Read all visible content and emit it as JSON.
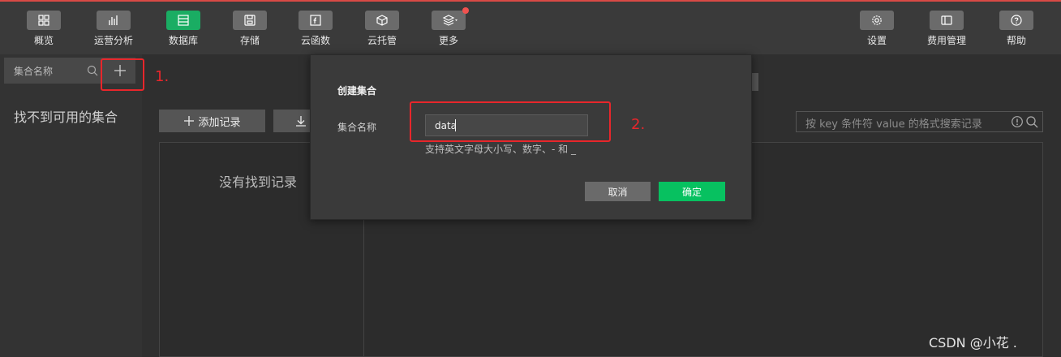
{
  "nav": {
    "left": [
      {
        "label": "概览",
        "icon": "overview-grid-icon"
      },
      {
        "label": "运营分析",
        "icon": "bar-chart-icon"
      },
      {
        "label": "数据库",
        "icon": "database-icon",
        "active": true
      },
      {
        "label": "存储",
        "icon": "storage-disk-icon"
      },
      {
        "label": "云函数",
        "icon": "cloud-function-icon"
      },
      {
        "label": "云托管",
        "icon": "cube-icon"
      },
      {
        "label": "更多",
        "icon": "layers-icon",
        "has_badge": true
      }
    ],
    "right": [
      {
        "label": "设置",
        "icon": "gear-icon"
      },
      {
        "label": "费用管理",
        "icon": "billing-icon"
      },
      {
        "label": "帮助",
        "icon": "help-icon"
      }
    ]
  },
  "sidebar": {
    "search_placeholder": "集合名称",
    "empty_text": "找不到可用的集合"
  },
  "toolbar": {
    "add_record_label": "添加记录",
    "search_placeholder": "按 key 条件符 value 的格式搜索记录"
  },
  "records": {
    "empty_text": "没有找到记录"
  },
  "dialog": {
    "title": "创建集合",
    "field_label": "集合名称",
    "field_value": "data",
    "hint": "支持英文字母大小写、数字、- 和 _",
    "cancel_label": "取消",
    "confirm_label": "确定"
  },
  "annotations": {
    "step1": "1.",
    "step2": "2.",
    "color": "#e8262b"
  },
  "colors": {
    "accent_green": "#07c160",
    "badge_red": "#f0524f"
  },
  "watermark": "CSDN @小花  ."
}
